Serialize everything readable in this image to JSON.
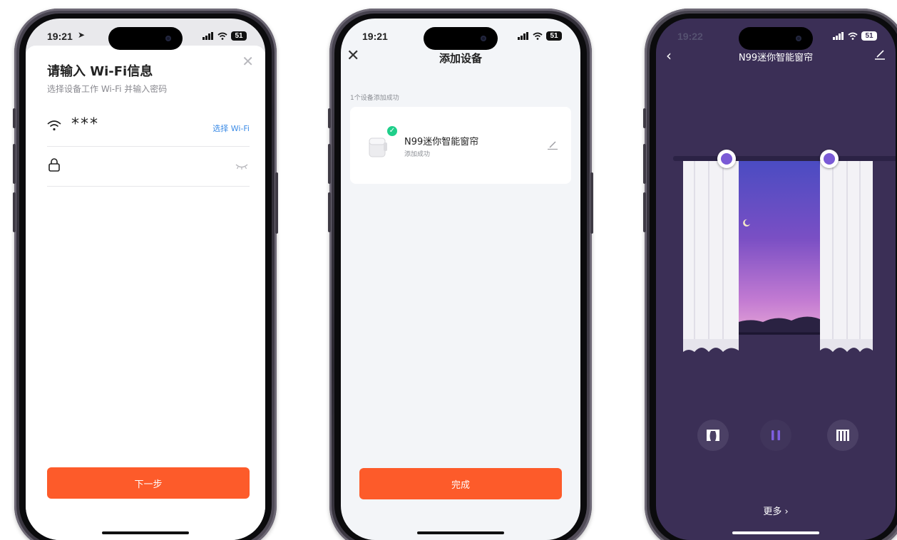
{
  "screens": [
    {
      "status_time": "19:21",
      "battery": "51",
      "title": "请输入 Wi-Fi信息",
      "subtitle": "选择设备工作 Wi-Fi 并输入密码",
      "wifi_name": "***",
      "choose_wifi": "选择 Wi-Fi",
      "password_value": "",
      "next_button": "下一步"
    },
    {
      "status_time": "19:21",
      "battery": "51",
      "title": "添加设备",
      "caption": "1个设备添加成功",
      "device_name": "N99迷你智能窗帘",
      "device_status": "添加成功",
      "done_button": "完成"
    },
    {
      "status_time": "19:22",
      "battery": "51",
      "title": "N99迷你智能窗帘",
      "more_link": "更多 ›"
    }
  ],
  "colors": {
    "accent": "#fd5b2a",
    "link": "#3b8be6",
    "success": "#1fcf8a",
    "curtain_bg": "#3b2f56",
    "knob": "#7a5ad6"
  }
}
